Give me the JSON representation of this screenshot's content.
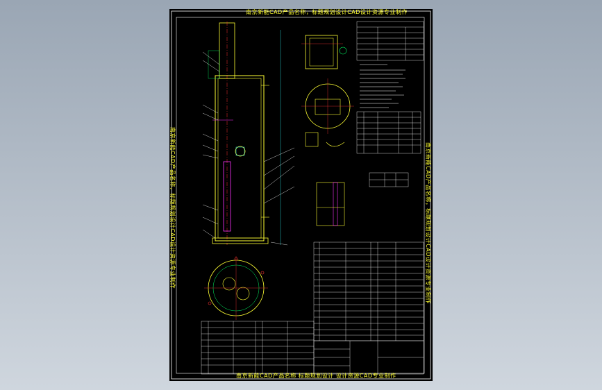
{
  "drawing": {
    "top_caption": "南京新能CAD产品名称，标题规划设计CAD设计资源专业制作",
    "bottom_caption": "南京新能CAD产品名称 标题规划设计 设计资源CAD专业制作",
    "left_caption": "南京新能CAD产品名称，标题规划设计CAD设计资源专业制作",
    "right_caption": "南京新能CAD产品名称，标题规划设计CAD设计资源专业制作"
  },
  "colors": {
    "background_top": "#9aa6b4",
    "background_bottom": "#cfd6de",
    "sheet": "#000000",
    "frame": "#ffffff",
    "part_outline": "#ffff33",
    "annotation": "#00ff66",
    "centerline": "#ff3333",
    "cyan_line": "#33ffff",
    "magenta_line": "#ff33ff"
  },
  "icons": {
    "leader": "leader-line-icon",
    "centerline": "centerline-icon"
  }
}
